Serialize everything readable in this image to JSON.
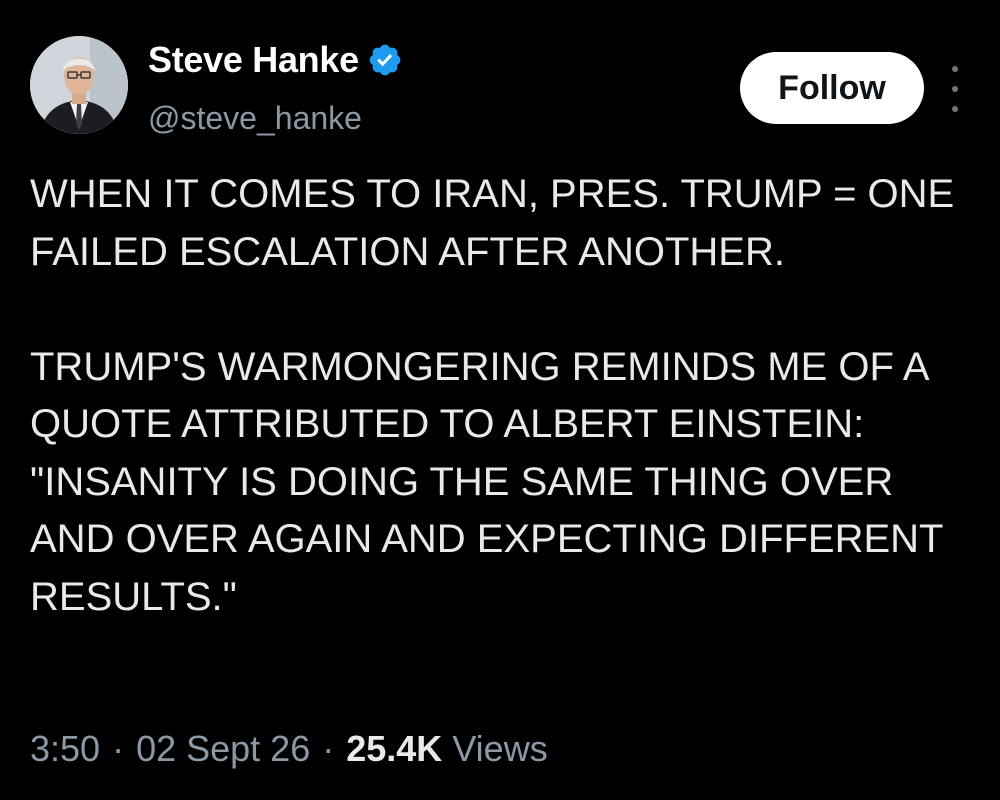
{
  "author": {
    "display_name": "Steve Hanke",
    "handle": "@steve_hanke",
    "verified": true,
    "verified_color": "#1d9bf0"
  },
  "actions": {
    "follow_label": "Follow",
    "more_icon": "more-vertical-icon"
  },
  "tweet": {
    "paragraphs": [
      "WHEN IT COMES TO IRAN, PRES. TRUMP = ONE FAILED ESCALATION AFTER ANOTHER.",
      "TRUMP'S WARMONGERING REMINDS ME OF A QUOTE ATTRIBUTED TO ALBERT EINSTEIN: \"INSANITY IS DOING THE SAME THING OVER AND OVER AGAIN AND EXPECTING DIFFERENT RESULTS.\""
    ]
  },
  "meta": {
    "time": "3:50",
    "separator": "·",
    "date": "02 Sept 26",
    "views_count": "25.4K",
    "views_label": "Views"
  },
  "colors": {
    "background": "#000000",
    "text_primary": "#e7e9ea",
    "text_secondary": "#8b98a5",
    "follow_bg": "#ffffff",
    "follow_text": "#0f1419"
  }
}
